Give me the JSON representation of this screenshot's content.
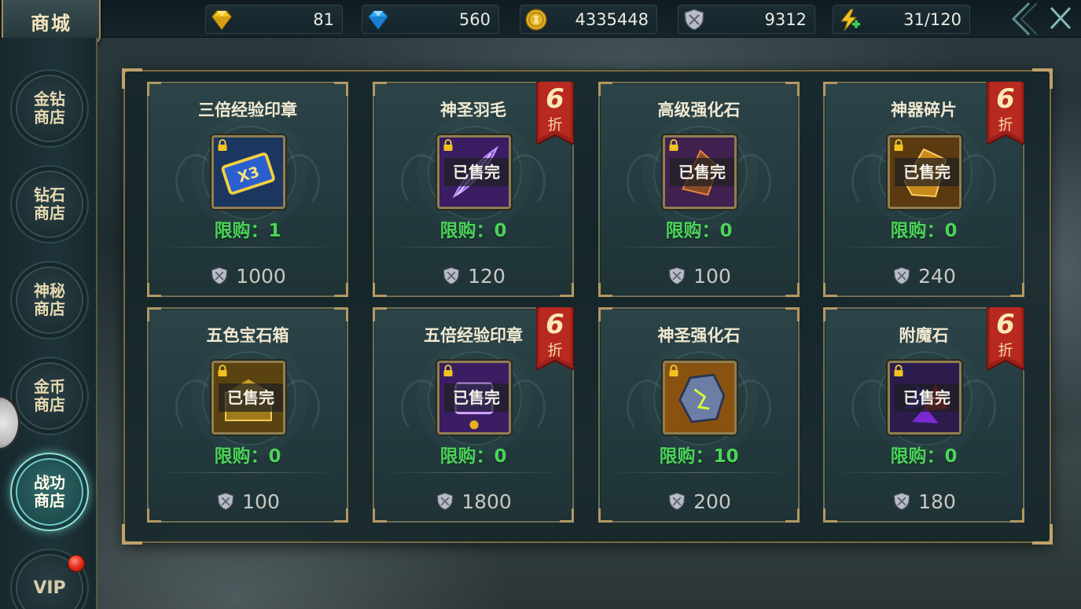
{
  "header": {
    "title": "商城",
    "resources": [
      {
        "name": "gold-gem",
        "value": "81",
        "color": "#f2c21f",
        "icon": "gem-gold-icon"
      },
      {
        "name": "diamond",
        "value": "560",
        "color": "#2fa6f0",
        "icon": "diamond-blue-icon"
      },
      {
        "name": "gold-coin",
        "value": "4335448",
        "color": "#e6b227",
        "icon": "coin-icon"
      },
      {
        "name": "merit",
        "value": "9312",
        "color": "#b8bcc8",
        "icon": "shield-icon"
      },
      {
        "name": "stamina",
        "value": "31/120",
        "color": "#f2c21f",
        "icon": "lightning-plus-icon"
      }
    ]
  },
  "sidebar": {
    "items": [
      {
        "label": "金钻\n商店",
        "active": false
      },
      {
        "label": "钻石\n商店",
        "active": false
      },
      {
        "label": "神秘\n商店",
        "active": false
      },
      {
        "label": "金币\n商店",
        "active": false
      },
      {
        "label": "战功\n商店",
        "active": true
      },
      {
        "label": "VIP",
        "active": false
      }
    ]
  },
  "shop": {
    "sold_out_label": "已售完",
    "limit_prefix": "限购：",
    "discount": {
      "number": "6",
      "unit": "折"
    },
    "items": [
      {
        "name": "三倍经验印章",
        "limit": "1",
        "price": "1000",
        "sold_out": false,
        "discount": false,
        "art": "exp-seal-x3"
      },
      {
        "name": "神圣羽毛",
        "limit": "0",
        "price": "120",
        "sold_out": true,
        "discount": true,
        "art": "feather"
      },
      {
        "name": "高级强化石",
        "limit": "0",
        "price": "100",
        "sold_out": true,
        "discount": false,
        "art": "stone"
      },
      {
        "name": "神器碎片",
        "limit": "0",
        "price": "240",
        "sold_out": true,
        "discount": true,
        "art": "shard"
      },
      {
        "name": "五色宝石箱",
        "limit": "0",
        "price": "100",
        "sold_out": true,
        "discount": false,
        "art": "gem-box"
      },
      {
        "name": "五倍经验印章",
        "limit": "0",
        "price": "1800",
        "sold_out": true,
        "discount": true,
        "art": "exp-seal-x5"
      },
      {
        "name": "神圣强化石",
        "limit": "10",
        "price": "200",
        "sold_out": false,
        "discount": false,
        "art": "holy-stone"
      },
      {
        "name": "附魔石",
        "limit": "0",
        "price": "180",
        "sold_out": true,
        "discount": true,
        "art": "enchant-stone"
      }
    ]
  }
}
